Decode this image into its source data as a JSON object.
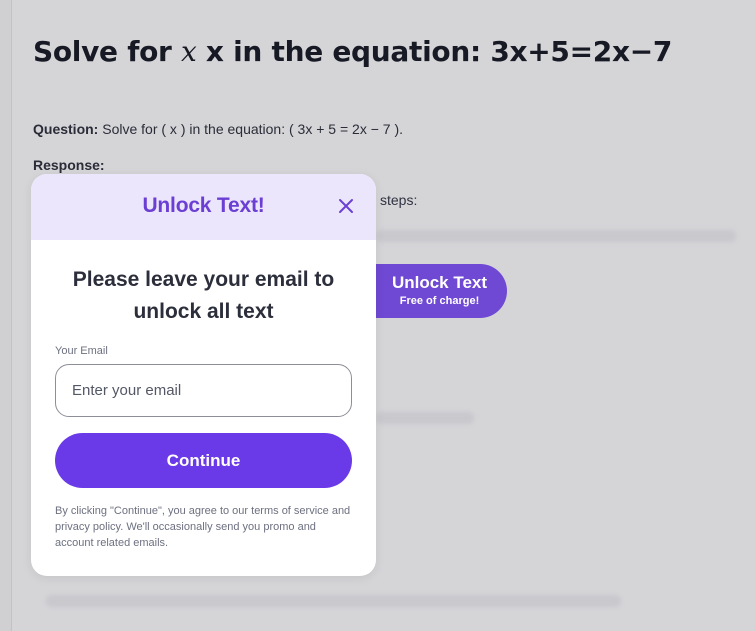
{
  "page": {
    "title_prefix": "Solve for ",
    "title_var": "x",
    "title_suffix": " x in the equation: 3x+5=2x−7",
    "question_label": "Question:",
    "question_text": " Solve for ( x ) in the equation: ( 3x + 5 = 2x − 7 ).",
    "response_label": "Response:",
    "steps_text": "steps:"
  },
  "unlock_button": {
    "title": "Unlock Text",
    "subtitle": "Free of charge!"
  },
  "modal": {
    "title": "Unlock Text!",
    "close_icon": "close-icon",
    "heading": "Please leave your email to unlock all text",
    "email_label": "Your Email",
    "email_placeholder": "Enter your email",
    "email_value": "",
    "continue_label": "Continue",
    "legal": "By clicking \"Continue\", you agree to our terms of service and privacy policy. We'll occasionally send you promo and account related emails."
  },
  "colors": {
    "accent": "#6b3ae8",
    "title_purple": "#6b3fd4",
    "header_bg": "#ebe6fb",
    "overlay_bg": "#d5d5d8"
  }
}
